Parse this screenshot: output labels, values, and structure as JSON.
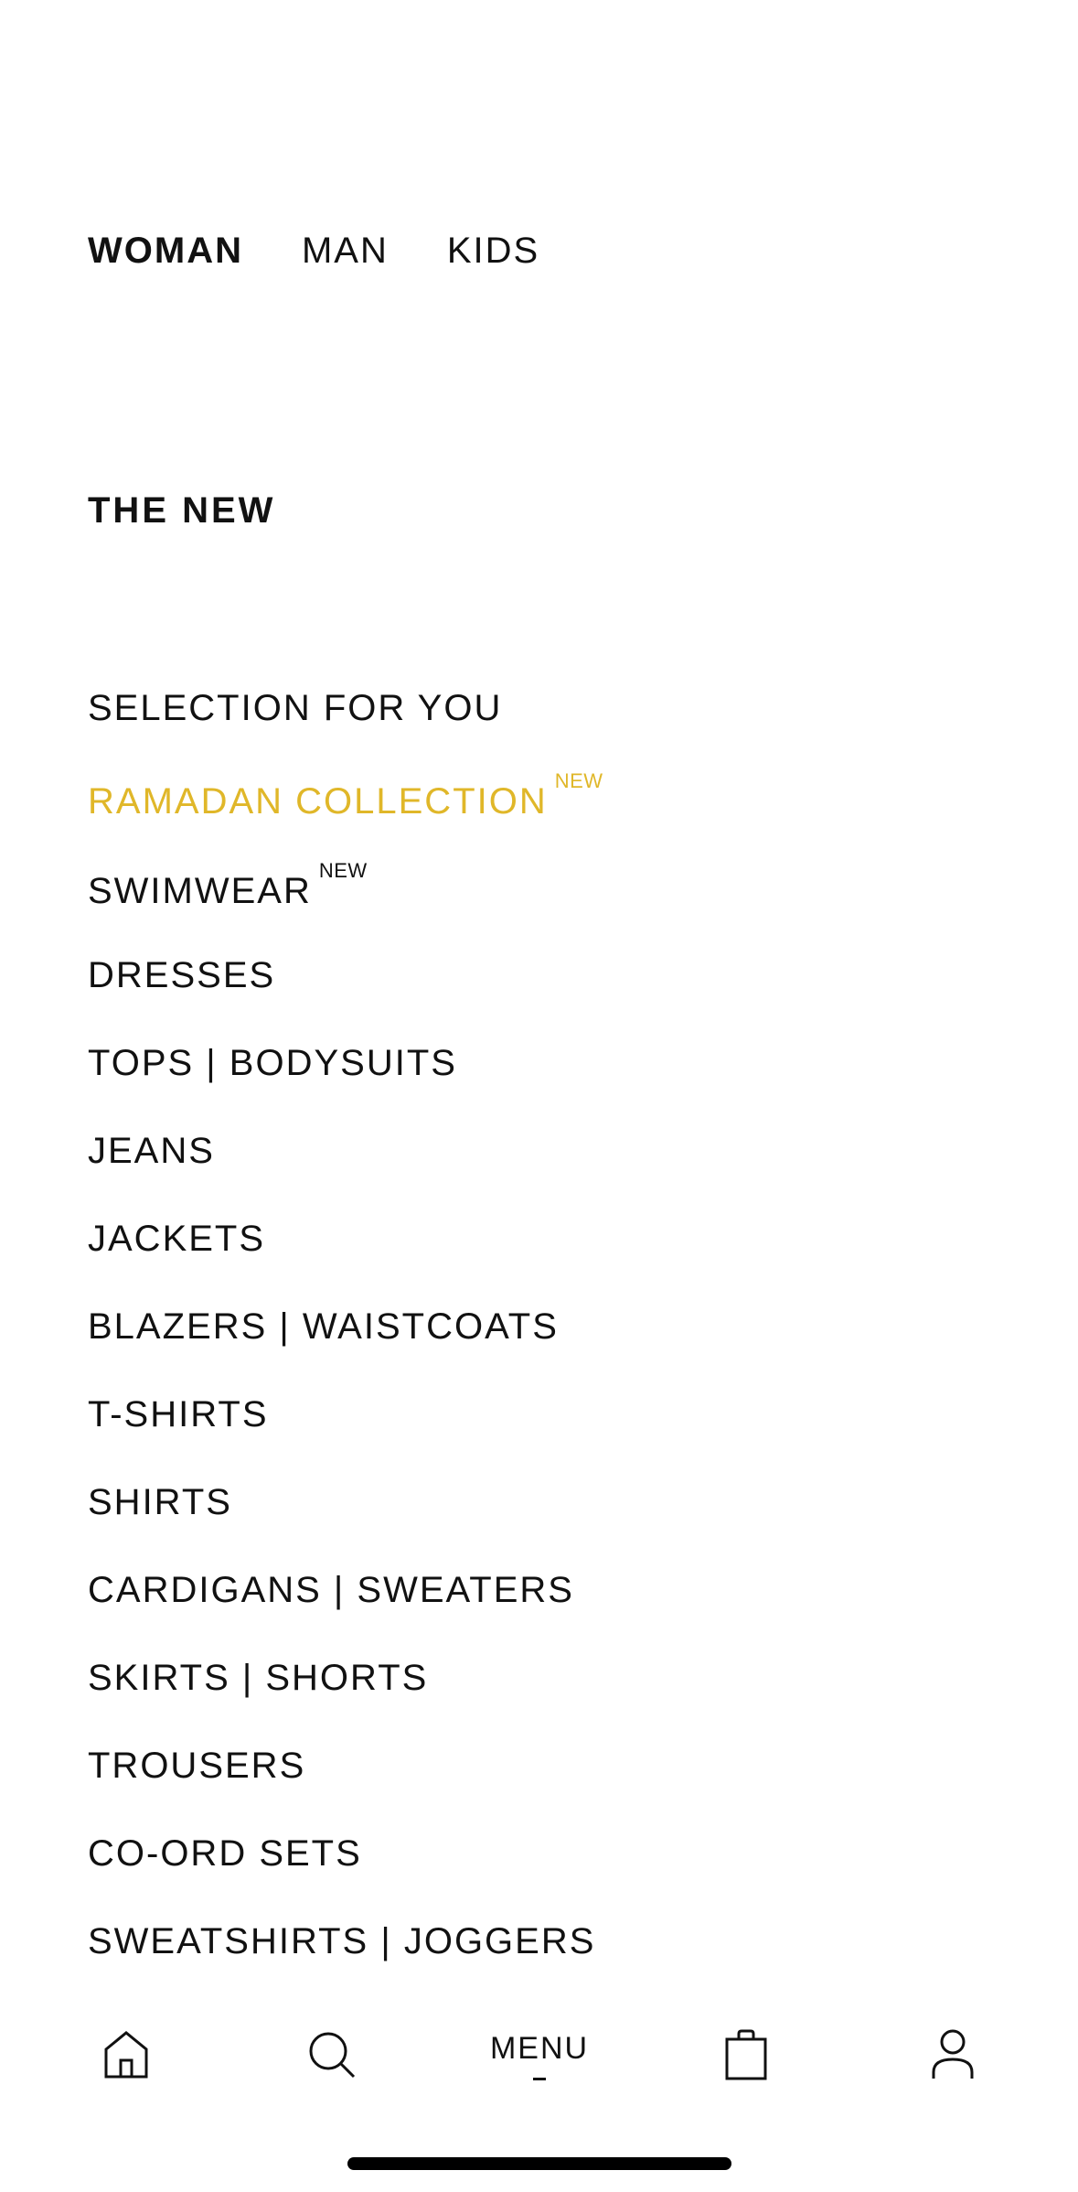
{
  "gender_tabs": [
    {
      "label": "WOMAN",
      "active": true
    },
    {
      "label": "MAN",
      "active": false
    },
    {
      "label": "KIDS",
      "active": false
    }
  ],
  "section_title": "THE NEW",
  "categories": [
    {
      "label": "SELECTION FOR YOU",
      "badge": "",
      "highlight": false
    },
    {
      "label": "RAMADAN COLLECTION",
      "badge": "NEW",
      "highlight": true
    },
    {
      "label": "SWIMWEAR",
      "badge": "NEW",
      "highlight": false
    },
    {
      "label": "DRESSES",
      "badge": "",
      "highlight": false
    },
    {
      "label": "TOPS | BODYSUITS",
      "badge": "",
      "highlight": false
    },
    {
      "label": "JEANS",
      "badge": "",
      "highlight": false
    },
    {
      "label": "JACKETS",
      "badge": "",
      "highlight": false
    },
    {
      "label": "BLAZERS | WAISTCOATS",
      "badge": "",
      "highlight": false
    },
    {
      "label": "T-SHIRTS",
      "badge": "",
      "highlight": false
    },
    {
      "label": "SHIRTS",
      "badge": "",
      "highlight": false
    },
    {
      "label": "CARDIGANS | SWEATERS",
      "badge": "",
      "highlight": false
    },
    {
      "label": "SKIRTS | SHORTS",
      "badge": "",
      "highlight": false
    },
    {
      "label": "TROUSERS",
      "badge": "",
      "highlight": false
    },
    {
      "label": "CO-ORD SETS",
      "badge": "",
      "highlight": false
    },
    {
      "label": "SWEATSHIRTS | JOGGERS",
      "badge": "",
      "highlight": false
    }
  ],
  "bottom_nav": {
    "home_icon": "home-icon",
    "search_icon": "search-icon",
    "menu_label": "MENU",
    "bag_icon": "shopping-bag-icon",
    "account_icon": "user-icon"
  },
  "colors": {
    "text": "#111111",
    "highlight": "#e0b729",
    "background": "#ffffff"
  }
}
